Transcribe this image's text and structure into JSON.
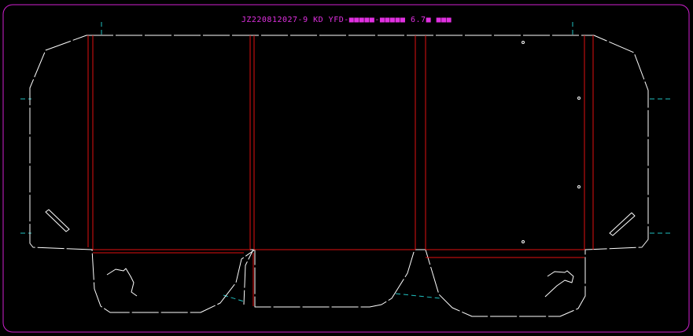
{
  "drawing": {
    "title": "JZ220812027-9 KD YFD-■■■■■-■■■■■ 6.7■ ■■■",
    "colors": {
      "background": "#000000",
      "frame": "#d020d0",
      "title": "#e030e0",
      "cut_line": "#ffffff",
      "crease_line": "#e01010",
      "guide_line": "#20c0c0"
    }
  }
}
